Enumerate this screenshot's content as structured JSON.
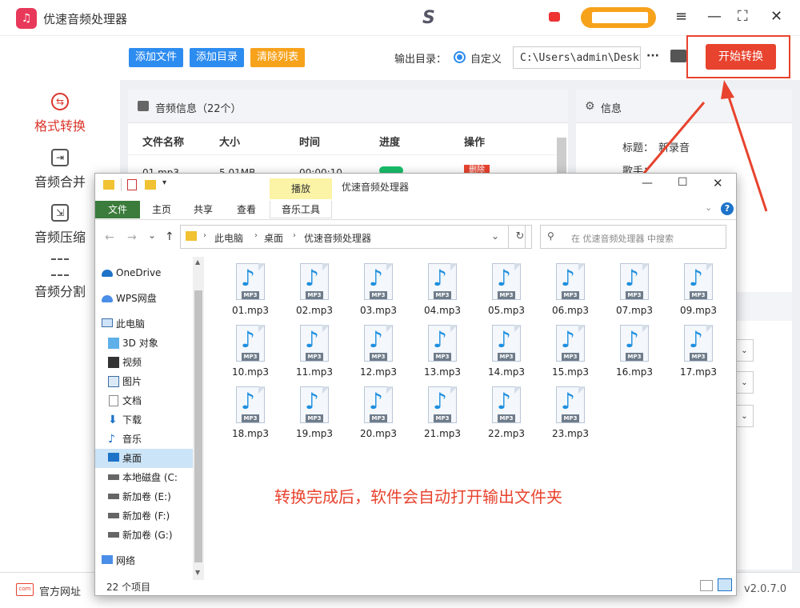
{
  "app": {
    "title": "优速音频处理器",
    "brand_glyph": "S",
    "window_controls": [
      "≡",
      "—",
      "⛶",
      "✕"
    ]
  },
  "sidebar": {
    "items": [
      {
        "label": "格式转换",
        "icon": "swap-icon",
        "active": true
      },
      {
        "label": "音频合并",
        "icon": "merge-icon",
        "active": false
      },
      {
        "label": "音频压缩",
        "icon": "compress-icon",
        "active": false
      },
      {
        "label": "音频分割",
        "icon": "split-icon",
        "active": false
      }
    ]
  },
  "toolbar": {
    "add_file": "添加文件",
    "add_dir": "添加目录",
    "clear_list": "清除列表",
    "output_label": "输出目录：",
    "custom_label": "自定义",
    "output_path": "C:\\Users\\admin\\Deskto",
    "more": "···",
    "start": "开始转换"
  },
  "audio_panel": {
    "title": "音频信息（22个）",
    "columns": [
      "文件名称",
      "大小",
      "时间",
      "进度",
      "操作"
    ],
    "row": {
      "name": "01.mp3",
      "size": "5.01MB",
      "time": "00:00:10",
      "action": "删除"
    }
  },
  "info_panel": {
    "title": "信息",
    "label_title": "标题：",
    "value_title": "新录音",
    "label_artist": "歌手："
  },
  "bottom": {
    "website": "官方网址",
    "version": "v2.0.7.0"
  },
  "explorer": {
    "title": "优速音频处理器",
    "play_tab": "播放",
    "ribbon_tabs": [
      "文件",
      "主页",
      "共享",
      "查看",
      "音乐工具"
    ],
    "breadcrumb": [
      "此电脑",
      "桌面",
      "优速音频处理器"
    ],
    "search_placeholder": "在 优速音频处理器 中搜索",
    "nav": [
      {
        "label": "OneDrive",
        "icon": "cloud-icon"
      },
      {
        "label": "WPS网盘",
        "icon": "cloud-icon"
      },
      {
        "label": "此电脑",
        "icon": "computer-icon"
      },
      {
        "label": "3D 对象",
        "icon": "cube-icon"
      },
      {
        "label": "视频",
        "icon": "video-icon"
      },
      {
        "label": "图片",
        "icon": "picture-icon"
      },
      {
        "label": "文档",
        "icon": "document-icon"
      },
      {
        "label": "下载",
        "icon": "download-icon"
      },
      {
        "label": "音乐",
        "icon": "music-icon"
      },
      {
        "label": "桌面",
        "icon": "desktop-icon",
        "selected": true
      },
      {
        "label": "本地磁盘 (C:",
        "icon": "drive-icon"
      },
      {
        "label": "新加卷 (E:)",
        "icon": "drive-icon"
      },
      {
        "label": "新加卷 (F:)",
        "icon": "drive-icon"
      },
      {
        "label": "新加卷 (G:)",
        "icon": "drive-icon"
      },
      {
        "label": "网络",
        "icon": "network-icon"
      }
    ],
    "files": [
      "01.mp3",
      "02.mp3",
      "03.mp3",
      "04.mp3",
      "05.mp3",
      "06.mp3",
      "07.mp3",
      "09.mp3",
      "10.mp3",
      "11.mp3",
      "12.mp3",
      "13.mp3",
      "14.mp3",
      "15.mp3",
      "16.mp3",
      "17.mp3",
      "18.mp3",
      "19.mp3",
      "20.mp3",
      "21.mp3",
      "22.mp3",
      "23.mp3"
    ],
    "file_tag": "MP3",
    "status": "22 个项目",
    "annotation": "转换完成后，软件会自动打开输出文件夹"
  },
  "colors": {
    "accent_red": "#e8432e",
    "blue_btn": "#2d8cf0",
    "orange_btn": "#f7a21b",
    "annotation": "#e8432e"
  }
}
